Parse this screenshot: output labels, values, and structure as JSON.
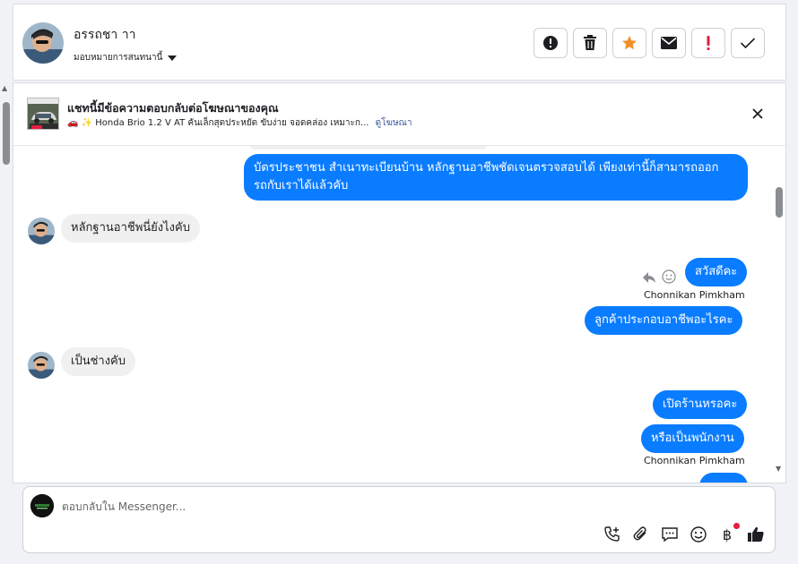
{
  "header": {
    "contact_name": "อรรถชา าา",
    "assign_label": "มอบหมายการสนทนานี้",
    "actions": [
      {
        "name": "report-icon",
        "color": "#1c1e21"
      },
      {
        "name": "trash-icon",
        "color": "#1c1e21"
      },
      {
        "name": "star-icon",
        "color": "#f0902a"
      },
      {
        "name": "mail-icon",
        "color": "#1c1e21"
      },
      {
        "name": "exclamation-icon",
        "color": "#e41e3f"
      },
      {
        "name": "check-icon",
        "color": "#1c1e21"
      }
    ]
  },
  "ad_banner": {
    "title": "แชทนี้มีข้อความตอบกลับต่อโฆษณาของคุณ",
    "subtitle": "🚗 ✨ Honda Brio 1.2 V AT คันเล็กสุดประหยัด ขับง่าย จอดคล่อง เหมาะก...",
    "link": "ดูโฆษณา"
  },
  "messages": [
    {
      "direction": "out",
      "text_lines": [
        "บัตรประชาชน สำเนาทะเบียนบ้าน หลักฐานอาชีพชัดเจนตรวจสอบได้ เพียงเท่านี้ก็สามารถออก",
        "รถกับเราได้แล้วคับ"
      ]
    },
    {
      "direction": "in",
      "text": "หลักฐานอาชีพนี่ยังไงคับ"
    },
    {
      "direction": "out",
      "text": "สวัสดีคะ",
      "sender": "Chonnikan Pimkham"
    },
    {
      "direction": "out",
      "text": "ลูกค้าประกอบอาชีพอะไรคะ"
    },
    {
      "direction": "in",
      "text": "เป็นช่างคับ"
    },
    {
      "direction": "out",
      "text": "เปิดร้านหรอคะ"
    },
    {
      "direction": "out",
      "text": "หรือเป็นพนักงาน",
      "sender": "Chonnikan Pimkham"
    }
  ],
  "composer": {
    "placeholder": "ตอบกลับใน Messenger...",
    "tools": [
      "phone-plus-icon",
      "paperclip-icon",
      "saved-reply-icon",
      "emoji-icon",
      "baht-icon",
      "thumbs-up-icon"
    ]
  },
  "colors": {
    "outgoing_bubble": "#0a7cff",
    "incoming_bubble": "#f0f0f0",
    "link": "#385898"
  }
}
